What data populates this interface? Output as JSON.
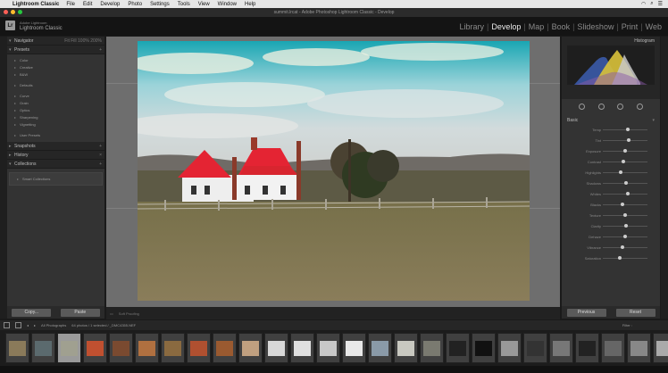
{
  "menubar": {
    "app": "Lightroom Classic",
    "items": [
      "File",
      "Edit",
      "Develop",
      "Photo",
      "Settings",
      "Tools",
      "View",
      "Window",
      "Help"
    ]
  },
  "window": {
    "title": "summit.lrcat - Adobe Photoshop Lightroom Classic - Develop"
  },
  "brand": {
    "line1": "Adobe Lightroom",
    "line2": "Lightroom Classic",
    "logo": "Lr"
  },
  "modules": [
    "Library",
    "Develop",
    "Map",
    "Book",
    "Slideshow",
    "Print",
    "Web"
  ],
  "active_module": "Develop",
  "left_panel": {
    "navigator": {
      "label": "Navigator",
      "zoom": [
        "Fit",
        "Fill",
        "100%",
        "200%"
      ]
    },
    "presets": {
      "label": "Presets",
      "items": [
        "Color",
        "Creative",
        "B&W",
        "Defaults",
        "Curve",
        "Grain",
        "Optics",
        "Sharpening",
        "Vignetting",
        "User Presets"
      ]
    },
    "snapshots": {
      "label": "Snapshots"
    },
    "history": {
      "label": "History"
    },
    "collections": {
      "label": "Collections",
      "items": [
        "Smart Collections"
      ]
    },
    "copy_label": "Copy...",
    "paste_label": "Paste"
  },
  "right_panel": {
    "histogram_label": "Histogram",
    "basic_label": "Basic",
    "sliders": [
      "Temp",
      "Tint",
      "Exposure",
      "Contrast",
      "Highlights",
      "Shadows",
      "Whites",
      "Blacks",
      "Texture",
      "Clarity",
      "Dehaze",
      "Vibrance",
      "Saturation"
    ],
    "previous_label": "Previous",
    "reset_label": "Reset"
  },
  "toolbar": {
    "soft_proofing": "Soft Proofing"
  },
  "filmstrip": {
    "source": "All Photographs",
    "info": "64 photos / 1 selected / _DMC4355.NEF",
    "filter_label": "Filter :",
    "thumb_count": 27,
    "selected_index": 2
  }
}
